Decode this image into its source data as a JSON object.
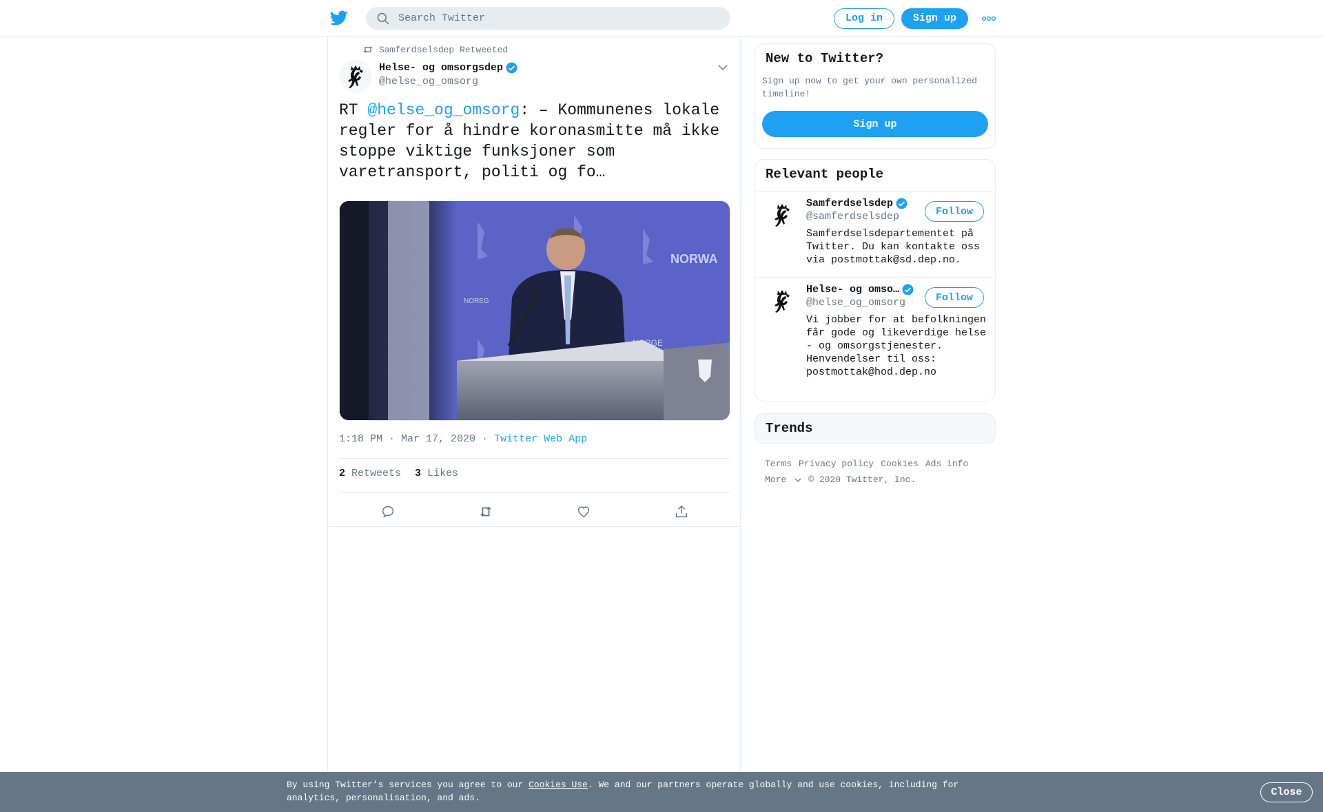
{
  "header": {
    "search_placeholder": "Search Twitter",
    "login_label": "Log in",
    "signup_label": "Sign up"
  },
  "tweet": {
    "retweeted_by": "Samferdselsdep Retweeted",
    "author_name": "Helse- og omsorgsdep",
    "author_handle": "@helse_og_omsorg",
    "text_prefix": "RT ",
    "text_mention": "@helse_og_omsorg",
    "text_body": ": – Kommunenes lokale regler for å hindre koronasmitte må ikke stoppe viktige funksjoner som varetransport, politi og fo…",
    "timestamp": "1:18 PM · Mar 17, 2020",
    "separator": " · ",
    "source": "Twitter Web App",
    "retweets_count": "2",
    "retweets_label": "Retweets",
    "likes_count": "3",
    "likes_label": "Likes"
  },
  "sidebar": {
    "new_title": "New to Twitter?",
    "new_subtitle": "Sign up now to get your own personalized timeline!",
    "signup_label": "Sign up",
    "people_title": "Relevant people",
    "people": [
      {
        "name": "Samferdselsdep",
        "handle": "@samferdselsdep",
        "bio": "Samferdselsdepartementet på Twitter. Du kan kontakte oss via postmottak@sd.dep.no.",
        "follow_label": "Follow"
      },
      {
        "name": "Helse- og omso…",
        "handle": "@helse_og_omsorg",
        "bio": "Vi jobber for at befolkningen får gode og likeverdige helse - og omsorgstjenester. Henvendelser til oss: postmottak@hod.dep.no",
        "follow_label": "Follow"
      }
    ],
    "trends_title": "Trends",
    "footer": {
      "terms": "Terms",
      "privacy": "Privacy policy",
      "cookies": "Cookies",
      "ads": "Ads info",
      "more": "More",
      "copyright": "© 2020 Twitter, Inc."
    }
  },
  "cookie_banner": {
    "text_before": "By using Twitter’s services you agree to our ",
    "link": "Cookies Use",
    "text_after": ". We and our partners operate globally and use cookies, including for analytics, personalisation, and ads.",
    "close_label": "Close"
  },
  "colors": {
    "accent": "#1da1f2",
    "secondary_text": "#657786",
    "border": "#e6ecf0",
    "banner": "#657786"
  },
  "icons": [
    "twitter-bird-icon",
    "search-icon",
    "more-dots-icon",
    "retweet-icon",
    "verified-icon",
    "chevron-down-icon",
    "reply-icon",
    "like-icon",
    "share-icon",
    "coat-of-arms-logo"
  ]
}
